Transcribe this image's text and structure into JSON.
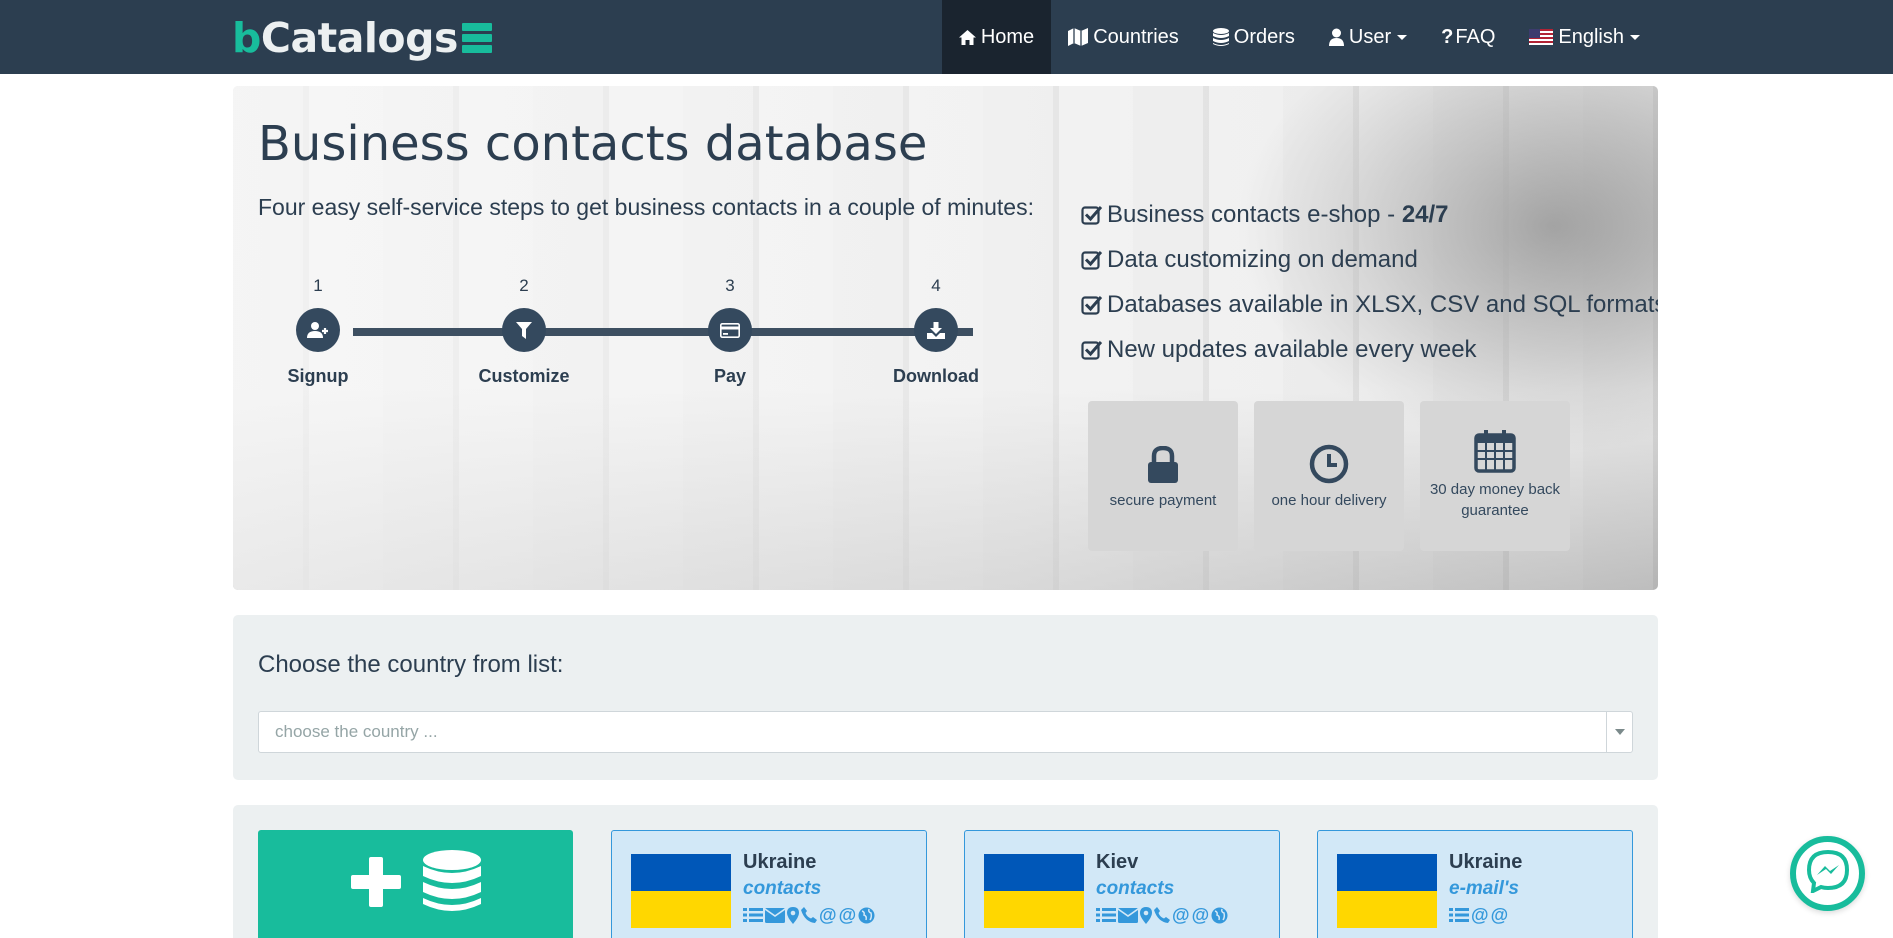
{
  "brand": {
    "first": "b",
    "rest": "Catalogs"
  },
  "nav": {
    "home": "Home",
    "countries": "Countries",
    "orders": "Orders",
    "user": "User",
    "faq": "FAQ",
    "language": "English"
  },
  "hero": {
    "title": "Business contacts database",
    "subtitle": "Four easy self-service steps to get business contacts in a couple of minutes:",
    "steps": [
      {
        "num": "1",
        "label": "Signup",
        "icon": "user-plus-icon"
      },
      {
        "num": "2",
        "label": "Customize",
        "icon": "filter-icon"
      },
      {
        "num": "3",
        "label": "Pay",
        "icon": "credit-card-icon"
      },
      {
        "num": "4",
        "label": "Download",
        "icon": "download-icon"
      }
    ],
    "features": [
      {
        "text": "Business contacts e-shop - ",
        "bold": "24/7"
      },
      {
        "text": "Data customizing on demand"
      },
      {
        "text": "Databases available in XLSX, CSV and SQL formats"
      },
      {
        "text": "New updates available every week"
      }
    ],
    "badges": [
      {
        "label": "secure payment",
        "icon": "lock-icon"
      },
      {
        "label": "one hour delivery",
        "icon": "clock-icon"
      },
      {
        "label": "30 day money back guarantee",
        "icon": "calendar-icon"
      }
    ]
  },
  "country_select": {
    "title": "Choose the country from list:",
    "placeholder": "choose the country ..."
  },
  "cards": [
    {
      "name": "Ukraine",
      "type": "contacts",
      "icons": [
        "list-icon",
        "envelope-icon",
        "map-marker-icon",
        "phone-icon",
        "at-icon",
        "at-icon",
        "globe-icon"
      ]
    },
    {
      "name": "Kiev",
      "type": "contacts",
      "icons": [
        "list-icon",
        "envelope-icon",
        "map-marker-icon",
        "phone-icon",
        "at-icon",
        "at-icon",
        "globe-icon"
      ]
    },
    {
      "name": "Ukraine",
      "type": "e-mail's",
      "icons": [
        "list-icon",
        "at-icon",
        "at-icon"
      ]
    }
  ],
  "colors": {
    "navbar": "#2c3e50",
    "accent": "#18bc9c",
    "card_bg": "#d2e8f7",
    "card_border": "#3498db",
    "flag_blue": "#0057b8",
    "flag_yellow": "#ffd700"
  }
}
